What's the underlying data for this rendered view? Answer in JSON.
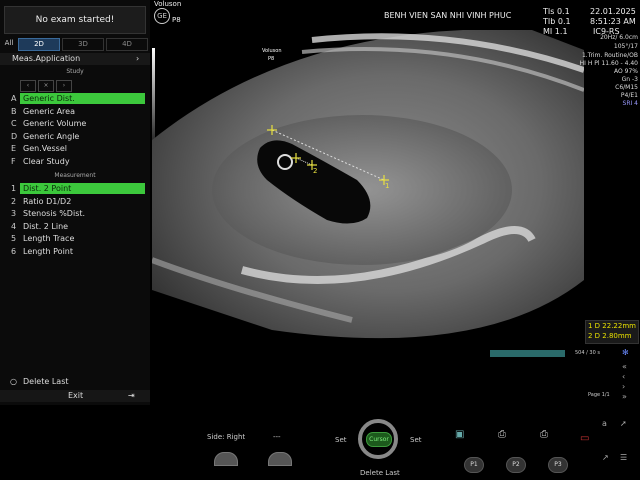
{
  "left": {
    "no_exam": "No exam started!",
    "modes": [
      "All",
      "2D",
      "3D",
      "4D"
    ],
    "meas_app": "Meas.Application",
    "study_header": "Study",
    "generic_items": [
      {
        "key": "A",
        "label": "Generic Dist."
      },
      {
        "key": "B",
        "label": "Generic Area"
      },
      {
        "key": "C",
        "label": "Generic Volume"
      },
      {
        "key": "D",
        "label": "Generic Angle"
      },
      {
        "key": "E",
        "label": "Gen.Vessel"
      },
      {
        "key": "F",
        "label": "Clear Study"
      }
    ],
    "measurement_header": "Measurement",
    "meas_items": [
      {
        "key": "1",
        "label": "Dist. 2 Point"
      },
      {
        "key": "2",
        "label": "Ratio D1/D2"
      },
      {
        "key": "3",
        "label": "Stenosis %Dist."
      },
      {
        "key": "4",
        "label": "Dist. 2 Line"
      },
      {
        "key": "5",
        "label": "Length Trace"
      },
      {
        "key": "6",
        "label": "Length Point"
      }
    ],
    "delete_last": "Delete Last",
    "exit": "Exit"
  },
  "header": {
    "hospital": "BENH VIEN SAN NHI VINH PHUC",
    "tis": "TIs 0.1",
    "tib": "TIb 0.1",
    "mi": "MI  1.1",
    "date": "22.01.2025",
    "time": "8:51:23 AM",
    "probe": "IC9-RS",
    "voluson": "Voluson",
    "p8": "P8"
  },
  "image": {
    "overlay_brand": "Voluson",
    "overlay_model": "P8",
    "caliper1": "1",
    "caliper2": "2"
  },
  "params": {
    "lines": [
      "20Hz/ 6.0cm",
      "105°/17",
      "1.Trim. Routine/OB",
      "HI H Pl 11.60 - 4.40",
      "AO 97%",
      "Gn -3",
      "C6/M15",
      "P4/E1",
      "SRI 4"
    ]
  },
  "results": {
    "r1": "1  D 22.22mm",
    "r2": "2  D  2.80mm"
  },
  "bottom": {
    "side_right": "Side: Right",
    "dashes": "---",
    "set_left": "Set",
    "cursor": "Cursor",
    "set_right": "Set",
    "delete_last": "Delete Last",
    "p1": "P1",
    "p2": "P2",
    "p3": "P3",
    "cine": "504 / 30 s",
    "page": "Page 1/1"
  }
}
